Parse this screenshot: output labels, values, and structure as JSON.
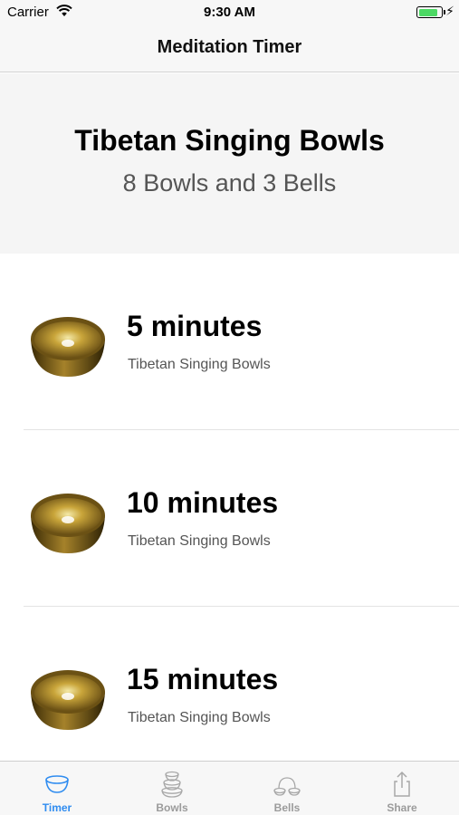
{
  "status_bar": {
    "carrier": "Carrier",
    "time": "9:30 AM",
    "battery_level": 0.8
  },
  "nav": {
    "title": "Meditation Timer"
  },
  "header": {
    "title": "Tibetan Singing Bowls",
    "subtitle": "8 Bowls and 3 Bells"
  },
  "list": {
    "items": [
      {
        "title": "5 minutes",
        "subtitle": "Tibetan Singing Bowls",
        "icon": "singing-bowl-icon"
      },
      {
        "title": "10 minutes",
        "subtitle": "Tibetan Singing Bowls",
        "icon": "singing-bowl-icon"
      },
      {
        "title": "15 minutes",
        "subtitle": "Tibetan Singing Bowls",
        "icon": "singing-bowl-icon"
      }
    ]
  },
  "tab_bar": {
    "active_index": 0,
    "accent_color": "#2f8cf0",
    "inactive_color": "#9b9b9b",
    "tabs": [
      {
        "label": "Timer",
        "icon": "timer-bowl-icon"
      },
      {
        "label": "Bowls",
        "icon": "bowls-stack-icon"
      },
      {
        "label": "Bells",
        "icon": "bells-icon"
      },
      {
        "label": "Share",
        "icon": "share-icon"
      }
    ]
  }
}
